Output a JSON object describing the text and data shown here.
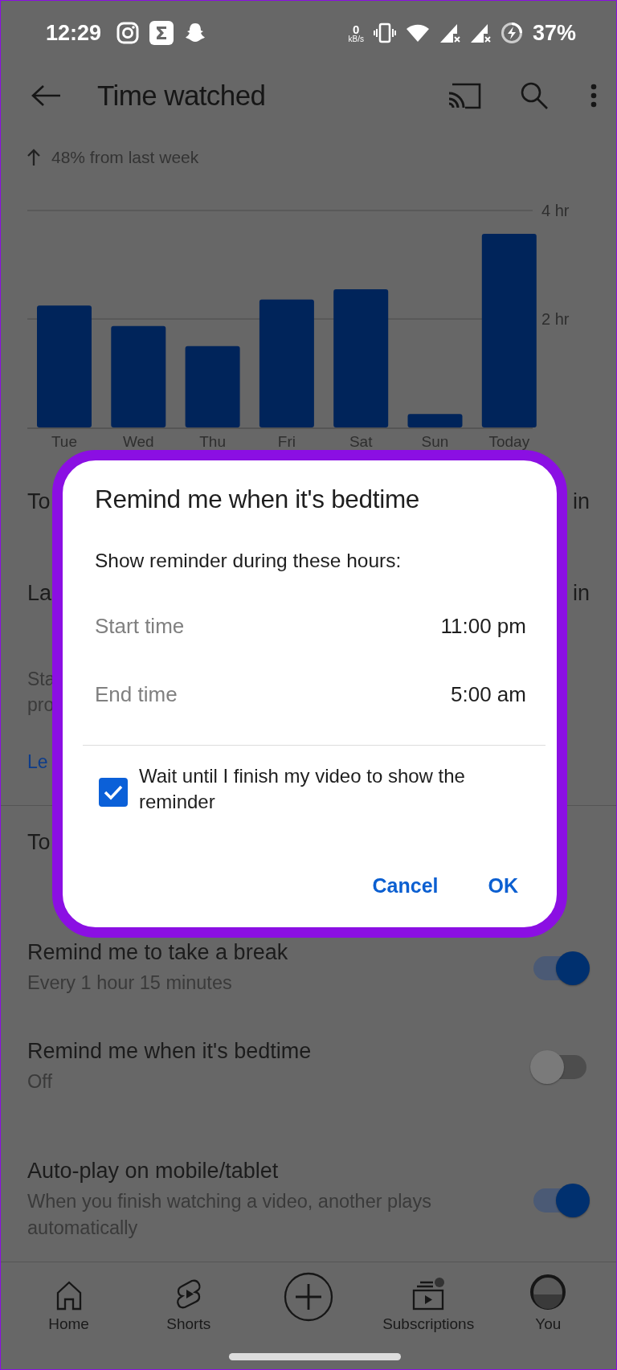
{
  "status_bar": {
    "time": "12:29",
    "net_speed_value": "0",
    "net_speed_unit": "kB/s",
    "battery": "37%"
  },
  "app_bar": {
    "title": "Time watched"
  },
  "summary": {
    "change": "48% from last week"
  },
  "chart": {
    "chart_data": {
      "type": "bar",
      "categories": [
        "Tue",
        "Wed",
        "Thu",
        "Fri",
        "Sat",
        "Sun",
        "Today"
      ],
      "values": [
        2.25,
        1.87,
        1.5,
        2.36,
        2.55,
        0.25,
        3.57
      ],
      "ylim": [
        0,
        4
      ],
      "yticks": [
        {
          "value": 2,
          "label": "2 hr"
        },
        {
          "value": 4,
          "label": "4 hr"
        }
      ]
    }
  },
  "covered_rows": [
    {
      "label": "To",
      "value": "in"
    },
    {
      "label": "La",
      "value": "in"
    }
  ],
  "covered_note": [
    "Sta",
    "pro"
  ],
  "covered_link": "Le",
  "covered_header": "To",
  "settings": [
    {
      "title": "Remind me to take a break",
      "subtitle": "Every 1 hour 15 minutes",
      "on": true
    },
    {
      "title": "Remind me when it's bedtime",
      "subtitle": "Off",
      "on": false
    },
    {
      "title": "Auto-play on mobile/tablet",
      "subtitle": "When you finish watching a video, another plays automatically",
      "on": true
    }
  ],
  "dialog": {
    "title": "Remind me when it's bedtime",
    "subtitle": "Show reminder during these hours:",
    "fields": [
      {
        "label": "Start time",
        "value": "11:00 pm"
      },
      {
        "label": "End time",
        "value": "5:00 am"
      }
    ],
    "checkbox": {
      "label": "Wait until I finish my video to show the reminder",
      "checked": true
    },
    "buttons": [
      {
        "label": "Cancel"
      },
      {
        "label": "OK"
      }
    ]
  },
  "bottom_nav": [
    {
      "kind": "home",
      "label": "Home"
    },
    {
      "kind": "shorts",
      "label": "Shorts"
    },
    {
      "kind": "create"
    },
    {
      "kind": "subscriptions",
      "label": "Subscriptions"
    },
    {
      "kind": "you",
      "label": "You"
    }
  ]
}
